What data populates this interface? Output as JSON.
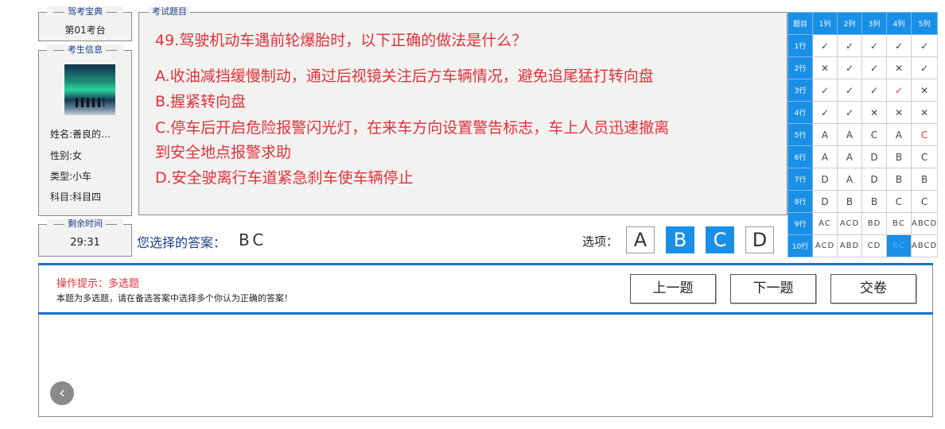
{
  "exam_book": {
    "title": "驾考宝典",
    "seat": "第01考台"
  },
  "candidate": {
    "title": "考生信息",
    "name": "姓名:善良的…",
    "gender": "性别:女",
    "type": "类型:小车",
    "subject": "科目:科目四"
  },
  "timer": {
    "title": "剩余时间",
    "value": "29:31"
  },
  "question": {
    "legend": "考试题目",
    "stem": "49.驾驶机动车遇前轮爆胎时，以下正确的做法是什么？",
    "option_a": "A.收油减挡缓慢制动，通过后视镜关注后方车辆情况，避免追尾猛打转向盘",
    "option_b": "B.握紧转向盘",
    "option_c_1": "C.停车后开启危险报警闪光灯，在来车方向设置警告标志，车上人员迅速撤离",
    "option_c_2": "到安全地点报警求助",
    "option_d": "D.安全驶离行车道紧急刹车使车辆停止"
  },
  "answer": {
    "label": "您选择的答案：",
    "value": "BC",
    "options_label": "选项：",
    "options": [
      "A",
      "B",
      "C",
      "D"
    ],
    "selected": [
      "B",
      "C"
    ]
  },
  "grid": {
    "header": [
      "题目",
      "1列",
      "2列",
      "3列",
      "4列",
      "5列"
    ],
    "rows": [
      {
        "label": "1行",
        "cells": [
          "✓",
          "✓",
          "✓",
          "✓",
          "✓"
        ]
      },
      {
        "label": "2行",
        "cells": [
          "✕",
          "✓",
          "✓",
          "✕",
          "✓"
        ]
      },
      {
        "label": "3行",
        "cells": [
          "✓",
          "✓",
          "✓",
          "✓",
          "✕"
        ]
      },
      {
        "label": "4行",
        "cells": [
          "✓",
          "✓",
          "✕",
          "✕",
          "✕"
        ]
      },
      {
        "label": "5行",
        "cells": [
          "A",
          "A",
          "C",
          "A",
          "C"
        ]
      },
      {
        "label": "6行",
        "cells": [
          "A",
          "A",
          "D",
          "B",
          "C"
        ]
      },
      {
        "label": "7行",
        "cells": [
          "D",
          "A",
          "D",
          "B",
          "B"
        ]
      },
      {
        "label": "8行",
        "cells": [
          "D",
          "B",
          "B",
          "C",
          "C"
        ]
      },
      {
        "label": "9行",
        "cells": [
          "AC",
          "ACD",
          "BD",
          "BC",
          "ABCD"
        ]
      },
      {
        "label": "10行",
        "cells": [
          "ACD",
          "ABD",
          "CD",
          "BC",
          "ABCD"
        ]
      }
    ]
  },
  "hint": {
    "title": "操作提示：多选题",
    "desc": "本题为多选题，请在备选答案中选择多个你认为正确的答案！"
  },
  "buttons": {
    "prev": "上一题",
    "next": "下一题",
    "submit": "交卷",
    "back": "‹"
  },
  "colors": {
    "accent": "#1a8fe6",
    "question_text": "#e0323a",
    "label_blue": "#1b3f8c"
  }
}
